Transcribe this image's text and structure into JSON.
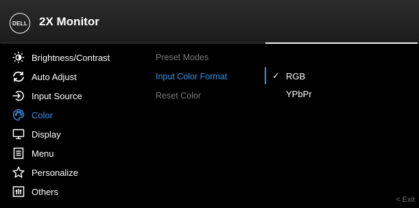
{
  "header": {
    "logo_text": "DELL",
    "title": "2X Monitor"
  },
  "menu": [
    {
      "label": "Brightness/Contrast",
      "icon": "brightness-icon",
      "active": false
    },
    {
      "label": "Auto Adjust",
      "icon": "auto-adjust-icon",
      "active": false
    },
    {
      "label": "Input Source",
      "icon": "input-source-icon",
      "active": false
    },
    {
      "label": "Color",
      "icon": "color-palette-icon",
      "active": true
    },
    {
      "label": "Display",
      "icon": "display-icon",
      "active": false
    },
    {
      "label": "Menu",
      "icon": "menu-icon",
      "active": false
    },
    {
      "label": "Personalize",
      "icon": "star-icon",
      "active": false
    },
    {
      "label": "Others",
      "icon": "others-icon",
      "active": false
    }
  ],
  "submenu": [
    {
      "label": "Preset Modes",
      "active": false
    },
    {
      "label": "Input Color Format",
      "active": true
    },
    {
      "label": "Reset Color",
      "active": false
    }
  ],
  "options": [
    {
      "label": "RGB",
      "selected": true,
      "check": "✓"
    },
    {
      "label": "YPbPr",
      "selected": false,
      "check": ""
    }
  ],
  "footer": {
    "exit_label": "< Exit"
  },
  "colors": {
    "accent": "#3b93e6",
    "inactive_text": "#7a7a7a",
    "background": "#000000",
    "titlebar": "#222222"
  }
}
